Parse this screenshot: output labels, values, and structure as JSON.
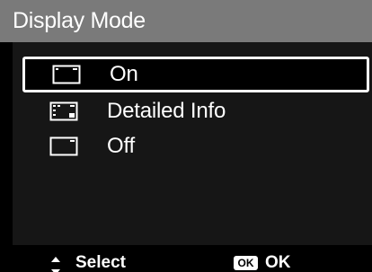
{
  "screen": {
    "title": "Display Mode"
  },
  "menu": {
    "items": [
      {
        "label": "On",
        "icon": "display-on-icon",
        "selected": true
      },
      {
        "label": "Detailed Info",
        "icon": "display-detailed-icon",
        "selected": false
      },
      {
        "label": "Off",
        "icon": "display-off-icon",
        "selected": false
      }
    ]
  },
  "footer": {
    "select_label": "Select",
    "ok_badge": "OK",
    "ok_label": "OK"
  },
  "colors": {
    "title_bar": "#7a7a7a",
    "panel": "#161616",
    "background": "#000000",
    "text": "#ffffff"
  }
}
